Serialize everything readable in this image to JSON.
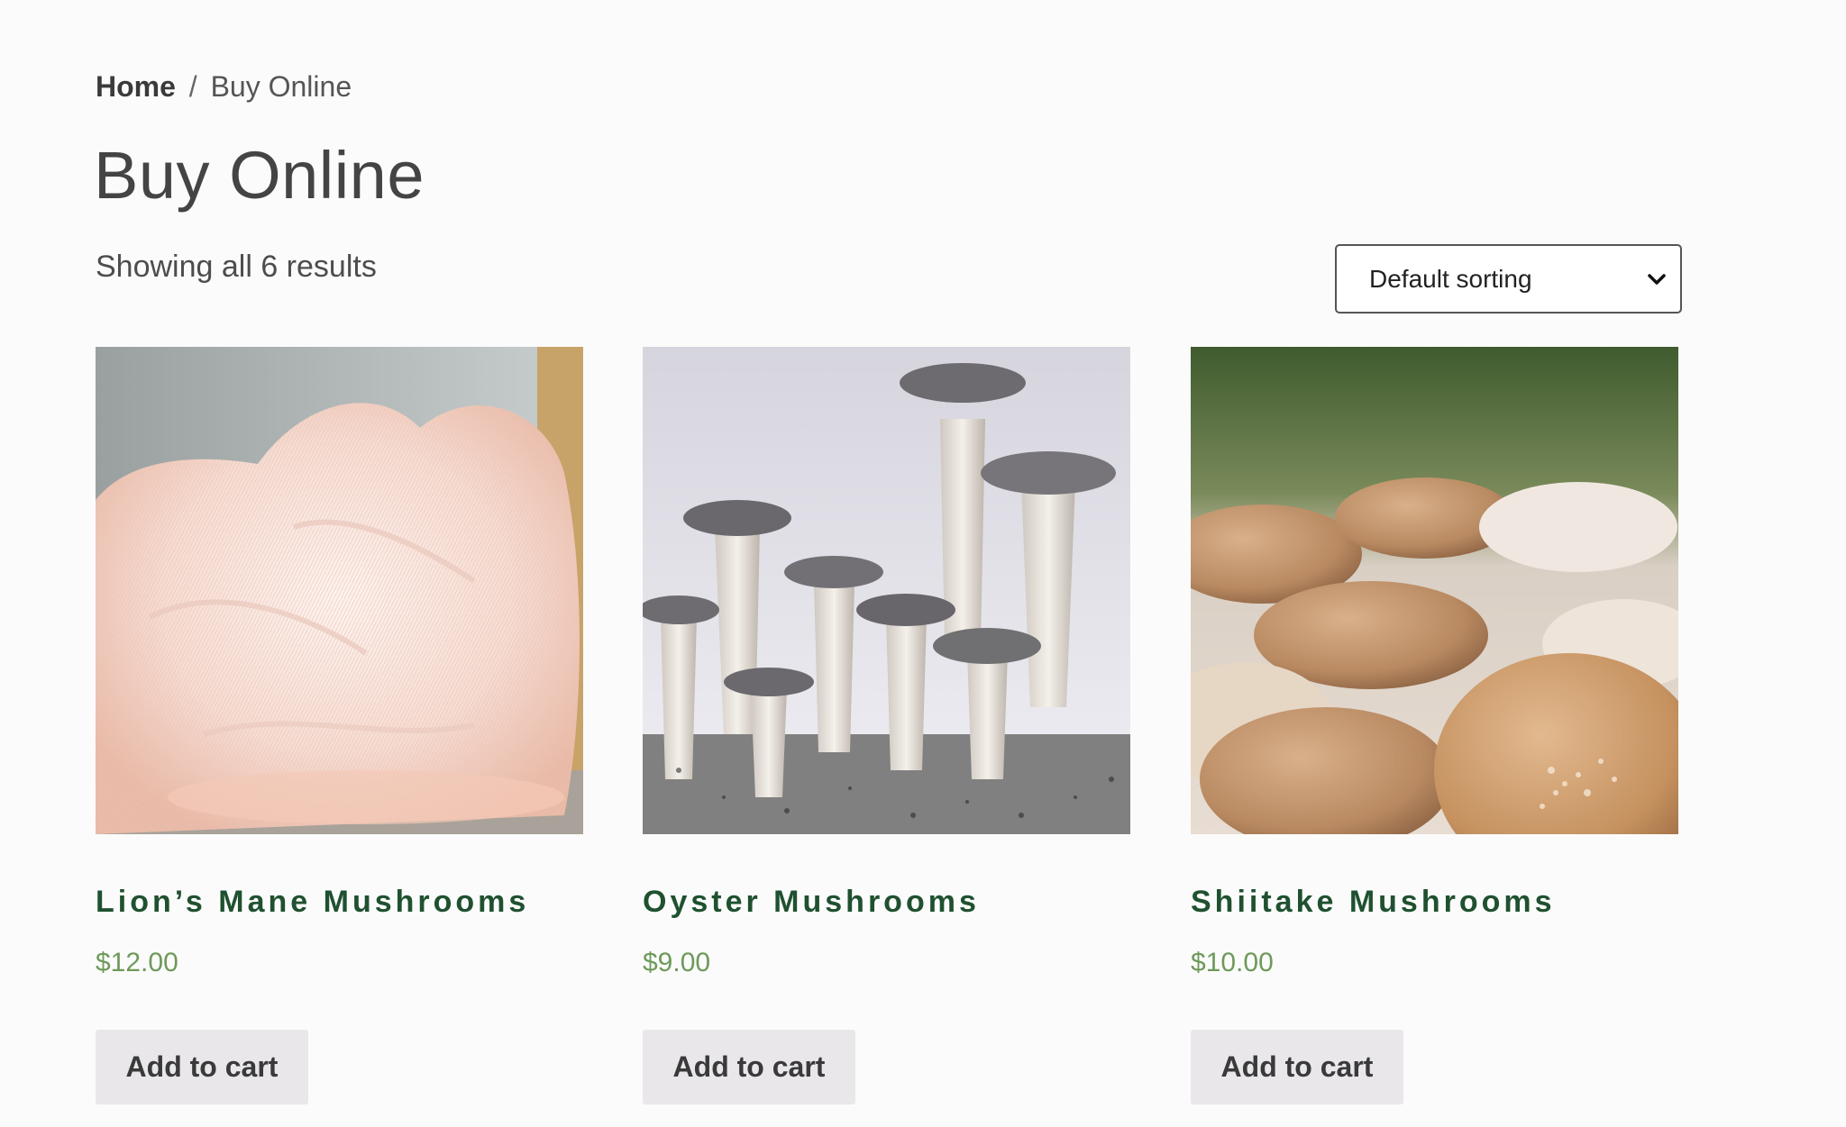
{
  "breadcrumb": {
    "home": "Home",
    "separator": "/",
    "current": "Buy Online"
  },
  "page_title": "Buy Online",
  "result_count": "Showing all 6 results",
  "sorting": {
    "selected": "Default sorting"
  },
  "products": [
    {
      "name": "Lion’s Mane Mushrooms",
      "price": "$12.00",
      "button": "Add to cart",
      "image": "lions-mane-mushroom-photo"
    },
    {
      "name": "Oyster Mushrooms",
      "price": "$9.00",
      "button": "Add to cart",
      "image": "oyster-mushroom-photo"
    },
    {
      "name": "Shiitake Mushrooms",
      "price": "$10.00",
      "button": "Add to cart",
      "image": "shiitake-mushroom-photo"
    }
  ],
  "colors": {
    "product_title": "#1f5130",
    "price": "#6d9a5a",
    "button_bg": "#e9e7ea",
    "page_bg": "#fcfbfb"
  }
}
